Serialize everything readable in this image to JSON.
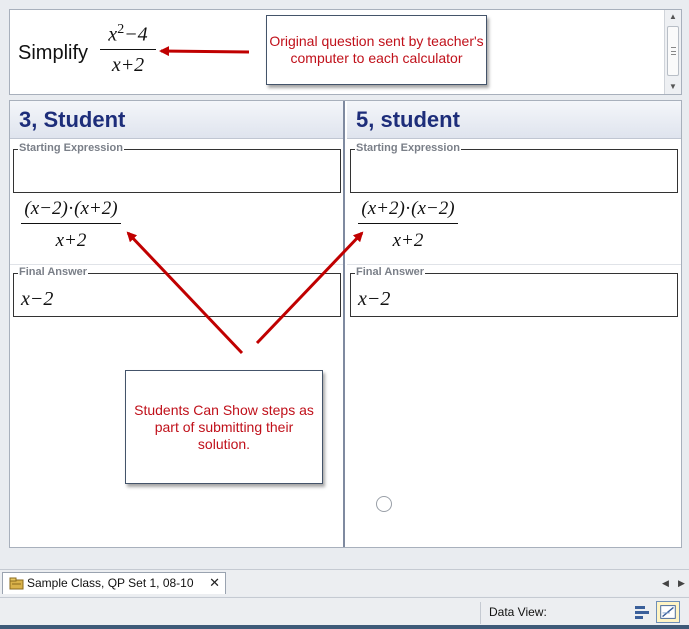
{
  "question": {
    "prompt": "Simplify",
    "numerator_base": "x",
    "numerator_exp": "2",
    "numerator_rest": "−4",
    "denominator": "x+2"
  },
  "callouts": {
    "top": "Original question sent by teacher's computer to each calculator",
    "bottom": "Students Can Show steps as part of submitting their solution."
  },
  "students": [
    {
      "name": "3, Student",
      "starting_label": "Starting Expression",
      "step_num_a": "(x−2)",
      "step_dot": "·",
      "step_num_b": "(x+2)",
      "step_den": "x+2",
      "final_label": "Final Answer",
      "final_value": "x−2"
    },
    {
      "name": "5, student",
      "starting_label": "Starting Expression",
      "step_num_a": "(x+2)",
      "step_dot": "·",
      "step_num_b": "(x−2)",
      "step_den": "x+2",
      "final_label": "Final Answer",
      "final_value": "x−2"
    }
  ],
  "tab": {
    "label": "Sample Class, QP Set 1, 08-10",
    "close": "✕",
    "prev": "◀",
    "next": "▶"
  },
  "statusbar": {
    "data_view_label": "Data View:"
  },
  "icons": {
    "tab": "class-folder-icon",
    "list_view": "list-view-icon",
    "chart_view": "chart-view-icon"
  },
  "colors": {
    "header_text": "#1d2d7a",
    "callout_text": "#c0101a",
    "arrow": "#c00000"
  }
}
